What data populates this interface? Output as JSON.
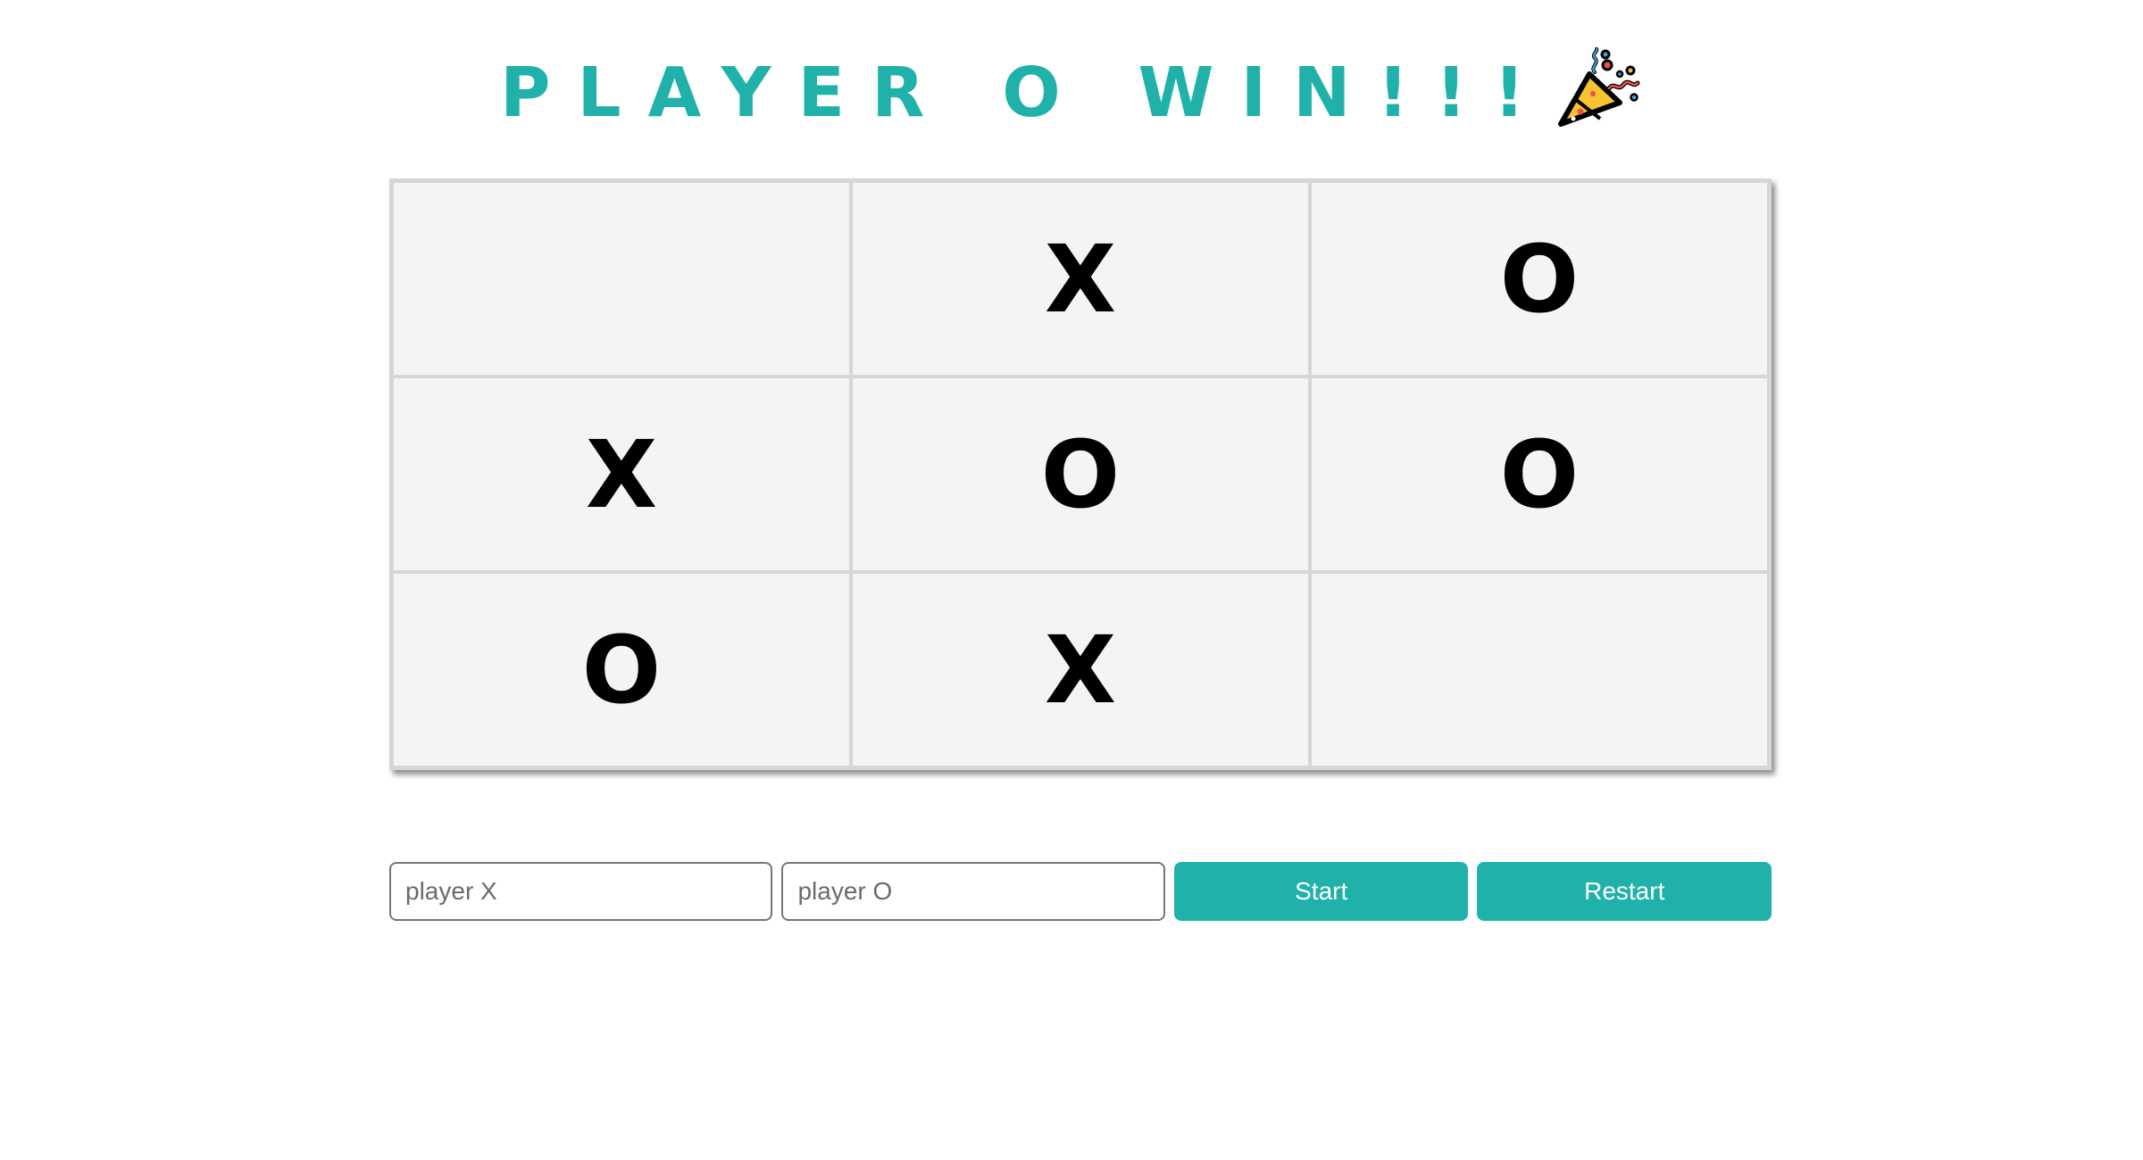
{
  "header": {
    "title": "PLAYER O WIN!!!",
    "icon": "party-popper-icon"
  },
  "board": {
    "cells": [
      "",
      "X",
      "O",
      "X",
      "O",
      "O",
      "O",
      "X",
      ""
    ]
  },
  "controls": {
    "player_x_placeholder": "player X",
    "player_o_placeholder": "player O",
    "start_label": "Start",
    "restart_label": "Restart"
  },
  "colors": {
    "accent": "#20b2aa",
    "board_background": "#f4f4f4",
    "grid_line": "#d6d6d6",
    "mark": "#000000"
  }
}
